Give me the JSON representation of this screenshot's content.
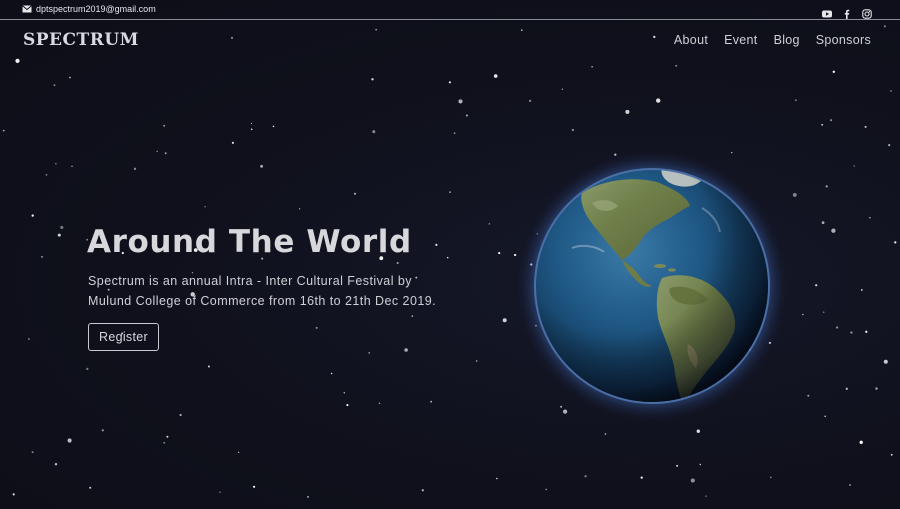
{
  "topbar": {
    "email": "dptspectrum2019@gmail.com",
    "email_icon": "envelope-icon",
    "social_icons": [
      "youtube-icon",
      "facebook-icon",
      "instagram-icon"
    ]
  },
  "header": {
    "logo": "SPECTRUM",
    "nav": [
      {
        "label": "About"
      },
      {
        "label": "Event"
      },
      {
        "label": "Blog"
      },
      {
        "label": "Sponsors"
      }
    ]
  },
  "hero": {
    "title": "Around The World",
    "description_line1": "Spectrum is an annual Intra - Inter Cultural Festival by",
    "description_line2": "Mulund College of Commerce from 16th to 21th Dec 2019.",
    "register_label": "Register",
    "image_name": "earth-globe"
  },
  "colors": {
    "background": "#0f101b",
    "text": "#d7d7dc",
    "ocean": "#1f4e78",
    "atmosphere": "#5b8fd6"
  }
}
